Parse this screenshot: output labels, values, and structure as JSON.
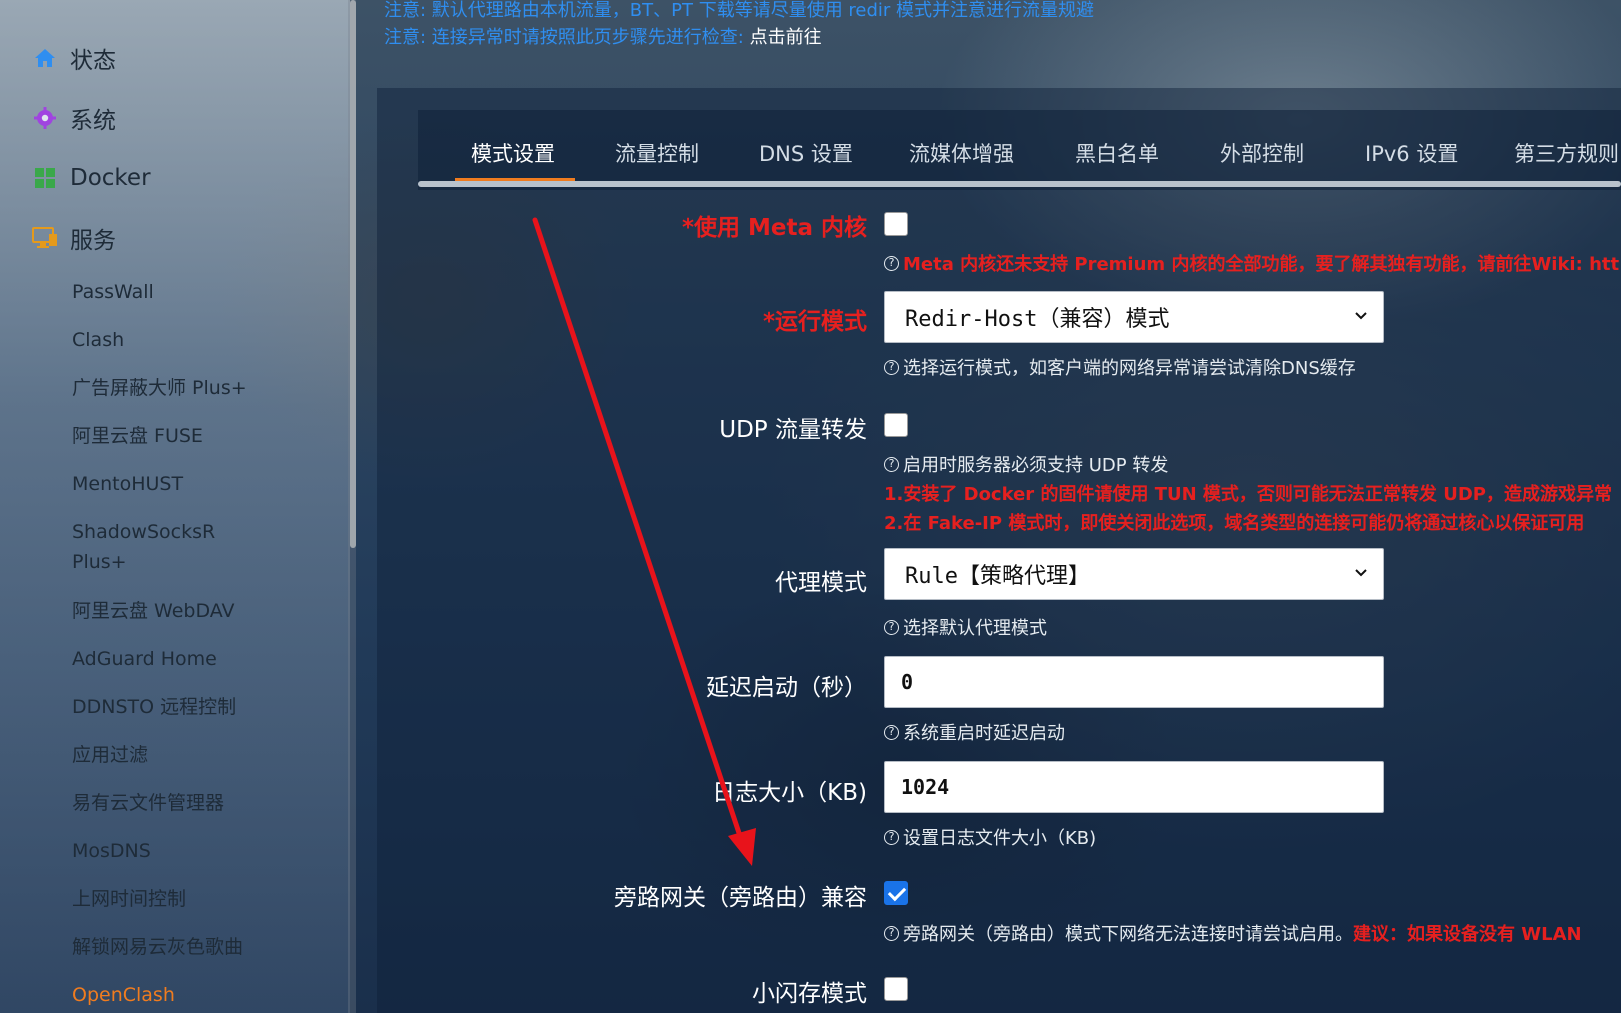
{
  "notices": {
    "line1": "注意: 默认代理路由本机流量，BT、PT 下载等请尽量使用 redir 模式并注意进行流量规避",
    "line2": "注意: 连接异常时请按照此页步骤先进行检查:",
    "line2_link": "点击前往"
  },
  "sidebar": {
    "main": [
      {
        "label": "状态",
        "icon": "home-icon",
        "color": "#2f8ef0"
      },
      {
        "label": "系统",
        "icon": "gear-icon",
        "color": "#a044e0"
      },
      {
        "label": "Docker",
        "icon": "grid-icon",
        "color": "#3aa84a"
      },
      {
        "label": "服务",
        "icon": "monitor-icon",
        "color": "#e59a1c"
      }
    ],
    "services": [
      "PassWall",
      "Clash",
      "广告屏蔽大师 Plus+",
      "阿里云盘 FUSE",
      "MentoHUST",
      "ShadowSocksR",
      "Plus+",
      "阿里云盘 WebDAV",
      "AdGuard Home",
      "DDNSTO 远程控制",
      "应用过滤",
      "易有云文件管理器",
      "MosDNS",
      "上网时间控制",
      "解锁网易云灰色歌曲",
      "OpenClash"
    ],
    "active": "OpenClash"
  },
  "tabs": [
    "模式设置",
    "流量控制",
    "DNS 设置",
    "流媒体增强",
    "黑白名单",
    "外部控制",
    "IPv6 设置",
    "第三方规则"
  ],
  "active_tab": "模式设置",
  "form": {
    "meta": {
      "label": "*使用 Meta 内核",
      "checked": false,
      "help_red": "Meta 内核还未支持 Premium 内核的全部功能，要了解其独有功能，请前往Wiki: htt"
    },
    "run_mode": {
      "label": "*运行模式",
      "value": "Redir-Host（兼容）模式",
      "help": "选择运行模式，如客户端的网络异常请尝试清除DNS缓存"
    },
    "udp": {
      "label": "UDP 流量转发",
      "checked": false,
      "help": "启用时服务器必须支持 UDP 转发",
      "warn1": "1.安装了 Docker 的固件请使用 TUN 模式，否则可能无法正常转发 UDP，造成游戏异常",
      "warn2": "2.在 Fake-IP 模式时，即使关闭此选项，域名类型的连接可能仍将通过核心以保证可用"
    },
    "proxy_mode": {
      "label": "代理模式",
      "value": "Rule【策略代理】",
      "help": "选择默认代理模式"
    },
    "delay": {
      "label": "延迟启动（秒）",
      "value": "0",
      "help": "系统重启时延迟启动"
    },
    "log_size": {
      "label": "日志大小（KB)",
      "value": "1024",
      "help": "设置日志文件大小（KB)"
    },
    "bypass": {
      "label": "旁路网关（旁路由）兼容",
      "checked": true,
      "help": "旁路网关（旁路由）模式下网络无法连接时请尝试启用。",
      "help_red": "建议：如果设备没有 WLAN"
    },
    "small_flash": {
      "label": "小闪存模式",
      "checked": false
    }
  },
  "colors": {
    "accent": "#f07c1f",
    "required": "#e6201f",
    "link": "#2f8ef0",
    "check": "#1a73e8"
  }
}
